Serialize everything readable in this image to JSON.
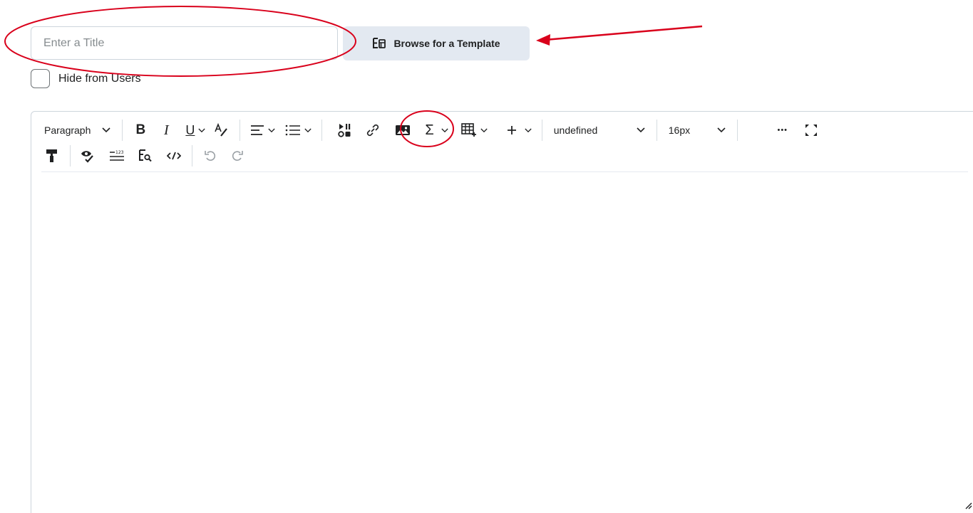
{
  "title_input": {
    "placeholder": "Enter a Title",
    "value": ""
  },
  "browse_button": {
    "label": "Browse for a Template"
  },
  "hide_checkbox": {
    "label": "Hide from Users",
    "checked": false
  },
  "toolbar": {
    "paragraph_label": "Paragraph",
    "font_family_label": "undefined",
    "font_size_label": "16px",
    "bold_glyph": "B",
    "italic_glyph": "I",
    "underline_glyph": "U",
    "more_glyph": "•••",
    "row1_icons": [
      "bold-icon",
      "italic-icon",
      "underline-icon",
      "text-color-icon",
      "align-icon",
      "list-icon",
      "media-icon",
      "link-icon",
      "image-icon",
      "equation-icon",
      "table-icon",
      "insert-icon",
      "more-icon",
      "fullscreen-icon"
    ],
    "row2_icons": [
      "format-painter-icon",
      "accessibility-checker-icon",
      "word-count-icon",
      "preview-icon",
      "source-code-icon",
      "undo-icon",
      "redo-icon"
    ]
  },
  "annotation_color": "#d9001b",
  "accent_button_bg": "#e3e9f1"
}
